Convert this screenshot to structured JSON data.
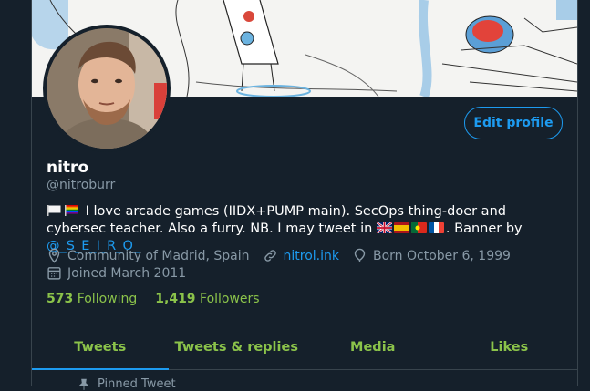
{
  "profile": {
    "name": "nitro",
    "handle": "@nitroburr",
    "edit_label": "Edit profile",
    "bio": {
      "part1": "I love arcade games (IIDX+PUMP main). SecOps thing-doer and cybersec teacher. Also a furry. NB.  I may tweet in ",
      "part2": ". Banner by ",
      "banner_credit": "@_S_E_I_R_O_"
    },
    "location": "Community of Madrid, Spain",
    "website": "nitrol.ink",
    "birthday": "Born October 6, 1999",
    "joined": "Joined March 2011",
    "following_count": "573",
    "following_label": "Following",
    "followers_count": "1,419",
    "followers_label": "Followers"
  },
  "tabs": [
    {
      "label": "Tweets"
    },
    {
      "label": "Tweets & replies"
    },
    {
      "label": "Media"
    },
    {
      "label": "Likes"
    }
  ],
  "pinned_label": "Pinned Tweet",
  "colors": {
    "background": "#15202b",
    "accent": "#1d9bf0",
    "highlight_green": "#8bc34a",
    "muted": "#8899a6"
  }
}
